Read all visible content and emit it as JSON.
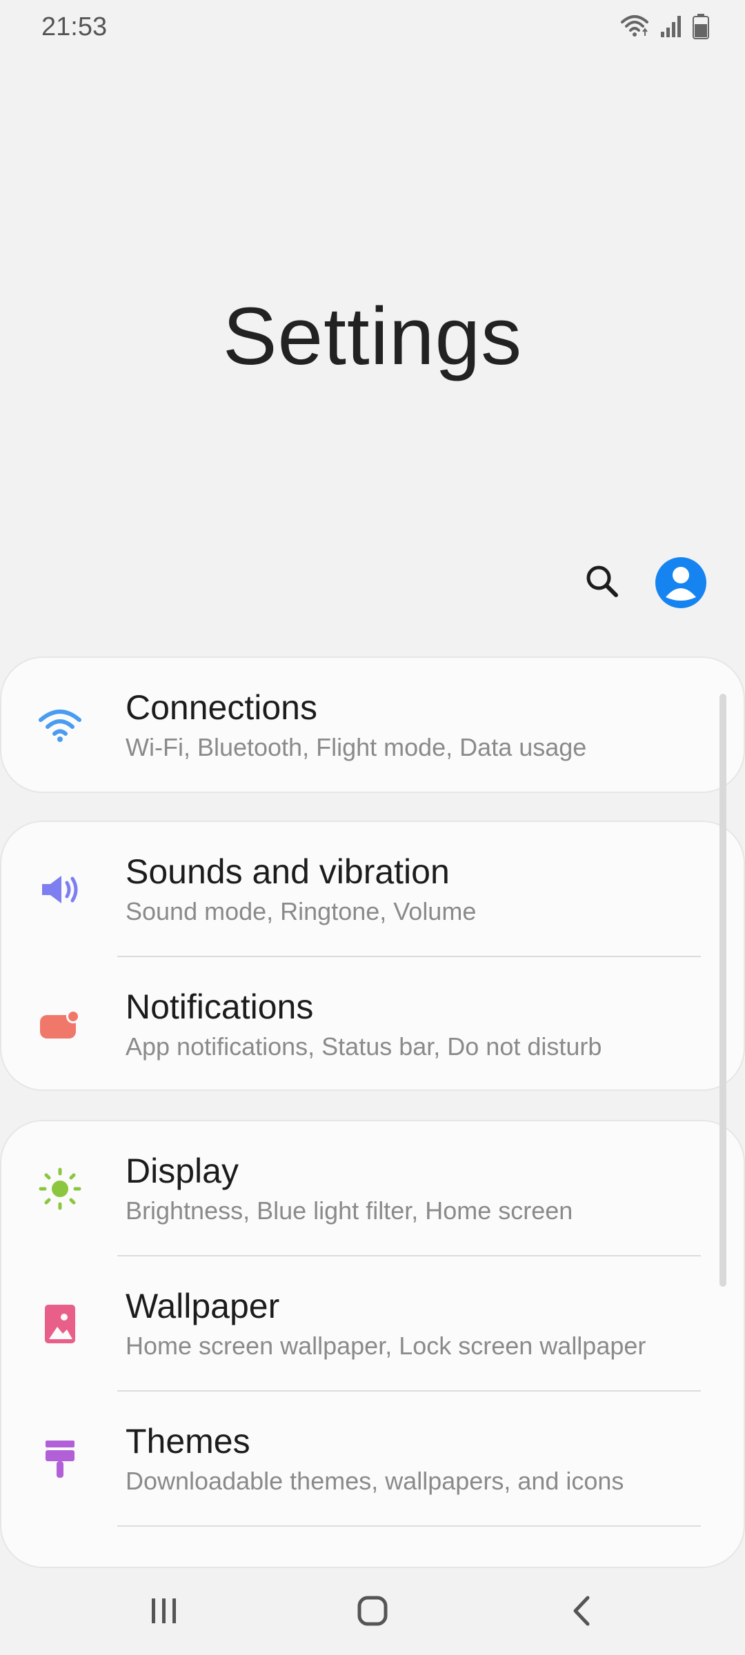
{
  "status_bar": {
    "time": "21:53",
    "icons": [
      "wifi-icon",
      "signal-icon",
      "battery-icon"
    ]
  },
  "header": {
    "title": "Settings",
    "search_icon": "search-icon",
    "avatar_icon": "account-icon",
    "accent_color": "#1584f0"
  },
  "groups": [
    {
      "items": [
        {
          "icon": "wifi-icon",
          "icon_color": "#4a9cf0",
          "title": "Connections",
          "subtitle": "Wi-Fi, Bluetooth, Flight mode, Data usage"
        }
      ]
    },
    {
      "items": [
        {
          "icon": "speaker-icon",
          "icon_color": "#7d7ef0",
          "title": "Sounds and vibration",
          "subtitle": "Sound mode, Ringtone, Volume"
        },
        {
          "icon": "notification-icon",
          "icon_color": "#f0786a",
          "title": "Notifications",
          "subtitle": "App notifications, Status bar, Do not disturb"
        }
      ]
    },
    {
      "items": [
        {
          "icon": "brightness-icon",
          "icon_color": "#8cc63f",
          "title": "Display",
          "subtitle": "Brightness, Blue light filter, Home screen"
        },
        {
          "icon": "wallpaper-icon",
          "icon_color": "#e8608a",
          "title": "Wallpaper",
          "subtitle": "Home screen wallpaper, Lock screen wallpaper"
        },
        {
          "icon": "paintbrush-icon",
          "icon_color": "#b160d8",
          "title": "Themes",
          "subtitle": "Downloadable themes, wallpapers, and icons"
        }
      ]
    }
  ],
  "nav_bar": {
    "icons": [
      "recents-icon",
      "home-icon",
      "back-icon"
    ]
  }
}
